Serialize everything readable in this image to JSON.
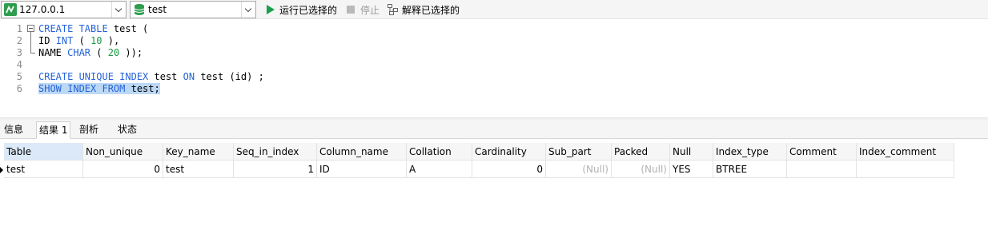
{
  "toolbar": {
    "connection": "127.0.0.1",
    "database": "test",
    "run_selected": "运行已选择的",
    "stop": "停止",
    "explain_selected": "解释已选择的"
  },
  "editor": {
    "lines": [
      {
        "n": "1",
        "parts": [
          {
            "t": "CREATE TABLE",
            "c": "kw"
          },
          {
            "t": " test (",
            "c": ""
          }
        ]
      },
      {
        "n": "2",
        "parts": [
          {
            "t": "ID ",
            "c": ""
          },
          {
            "t": "INT",
            "c": "kw"
          },
          {
            "t": " ( ",
            "c": ""
          },
          {
            "t": "10",
            "c": "num"
          },
          {
            "t": " ),",
            "c": ""
          }
        ]
      },
      {
        "n": "3",
        "parts": [
          {
            "t": "NAME ",
            "c": ""
          },
          {
            "t": "CHAR",
            "c": "kw"
          },
          {
            "t": " ( ",
            "c": ""
          },
          {
            "t": "20",
            "c": "num"
          },
          {
            "t": " ));",
            "c": ""
          }
        ]
      },
      {
        "n": "4",
        "parts": []
      },
      {
        "n": "5",
        "parts": [
          {
            "t": "CREATE UNIQUE INDEX",
            "c": "kw"
          },
          {
            "t": " test ",
            "c": ""
          },
          {
            "t": "ON",
            "c": "kw"
          },
          {
            "t": " test (id) ;",
            "c": ""
          }
        ]
      },
      {
        "n": "6",
        "parts": [
          {
            "t": "SHOW INDEX FROM",
            "c": "kw sel"
          },
          {
            "t": " test;",
            "c": "sel"
          }
        ]
      }
    ]
  },
  "tabs": [
    {
      "label": "信息",
      "active": false
    },
    {
      "label": "结果 1",
      "active": true
    },
    {
      "label": "剖析",
      "active": false
    },
    {
      "label": "状态",
      "active": false
    }
  ],
  "grid": {
    "columns": [
      "Table",
      "Non_unique",
      "Key_name",
      "Seq_in_index",
      "Column_name",
      "Collation",
      "Cardinality",
      "Sub_part",
      "Packed",
      "Null",
      "Index_type",
      "Comment",
      "Index_comment"
    ],
    "rows": [
      [
        "test",
        "0",
        "test",
        "1",
        "ID",
        "A",
        "0",
        "(Null)",
        "(Null)",
        "YES",
        "BTREE",
        "",
        ""
      ]
    ]
  },
  "colors": {
    "keyword": "#2563d9",
    "number": "#1a9a45",
    "selection": "#bcd8f5",
    "run_icon": "#1aa04c"
  }
}
